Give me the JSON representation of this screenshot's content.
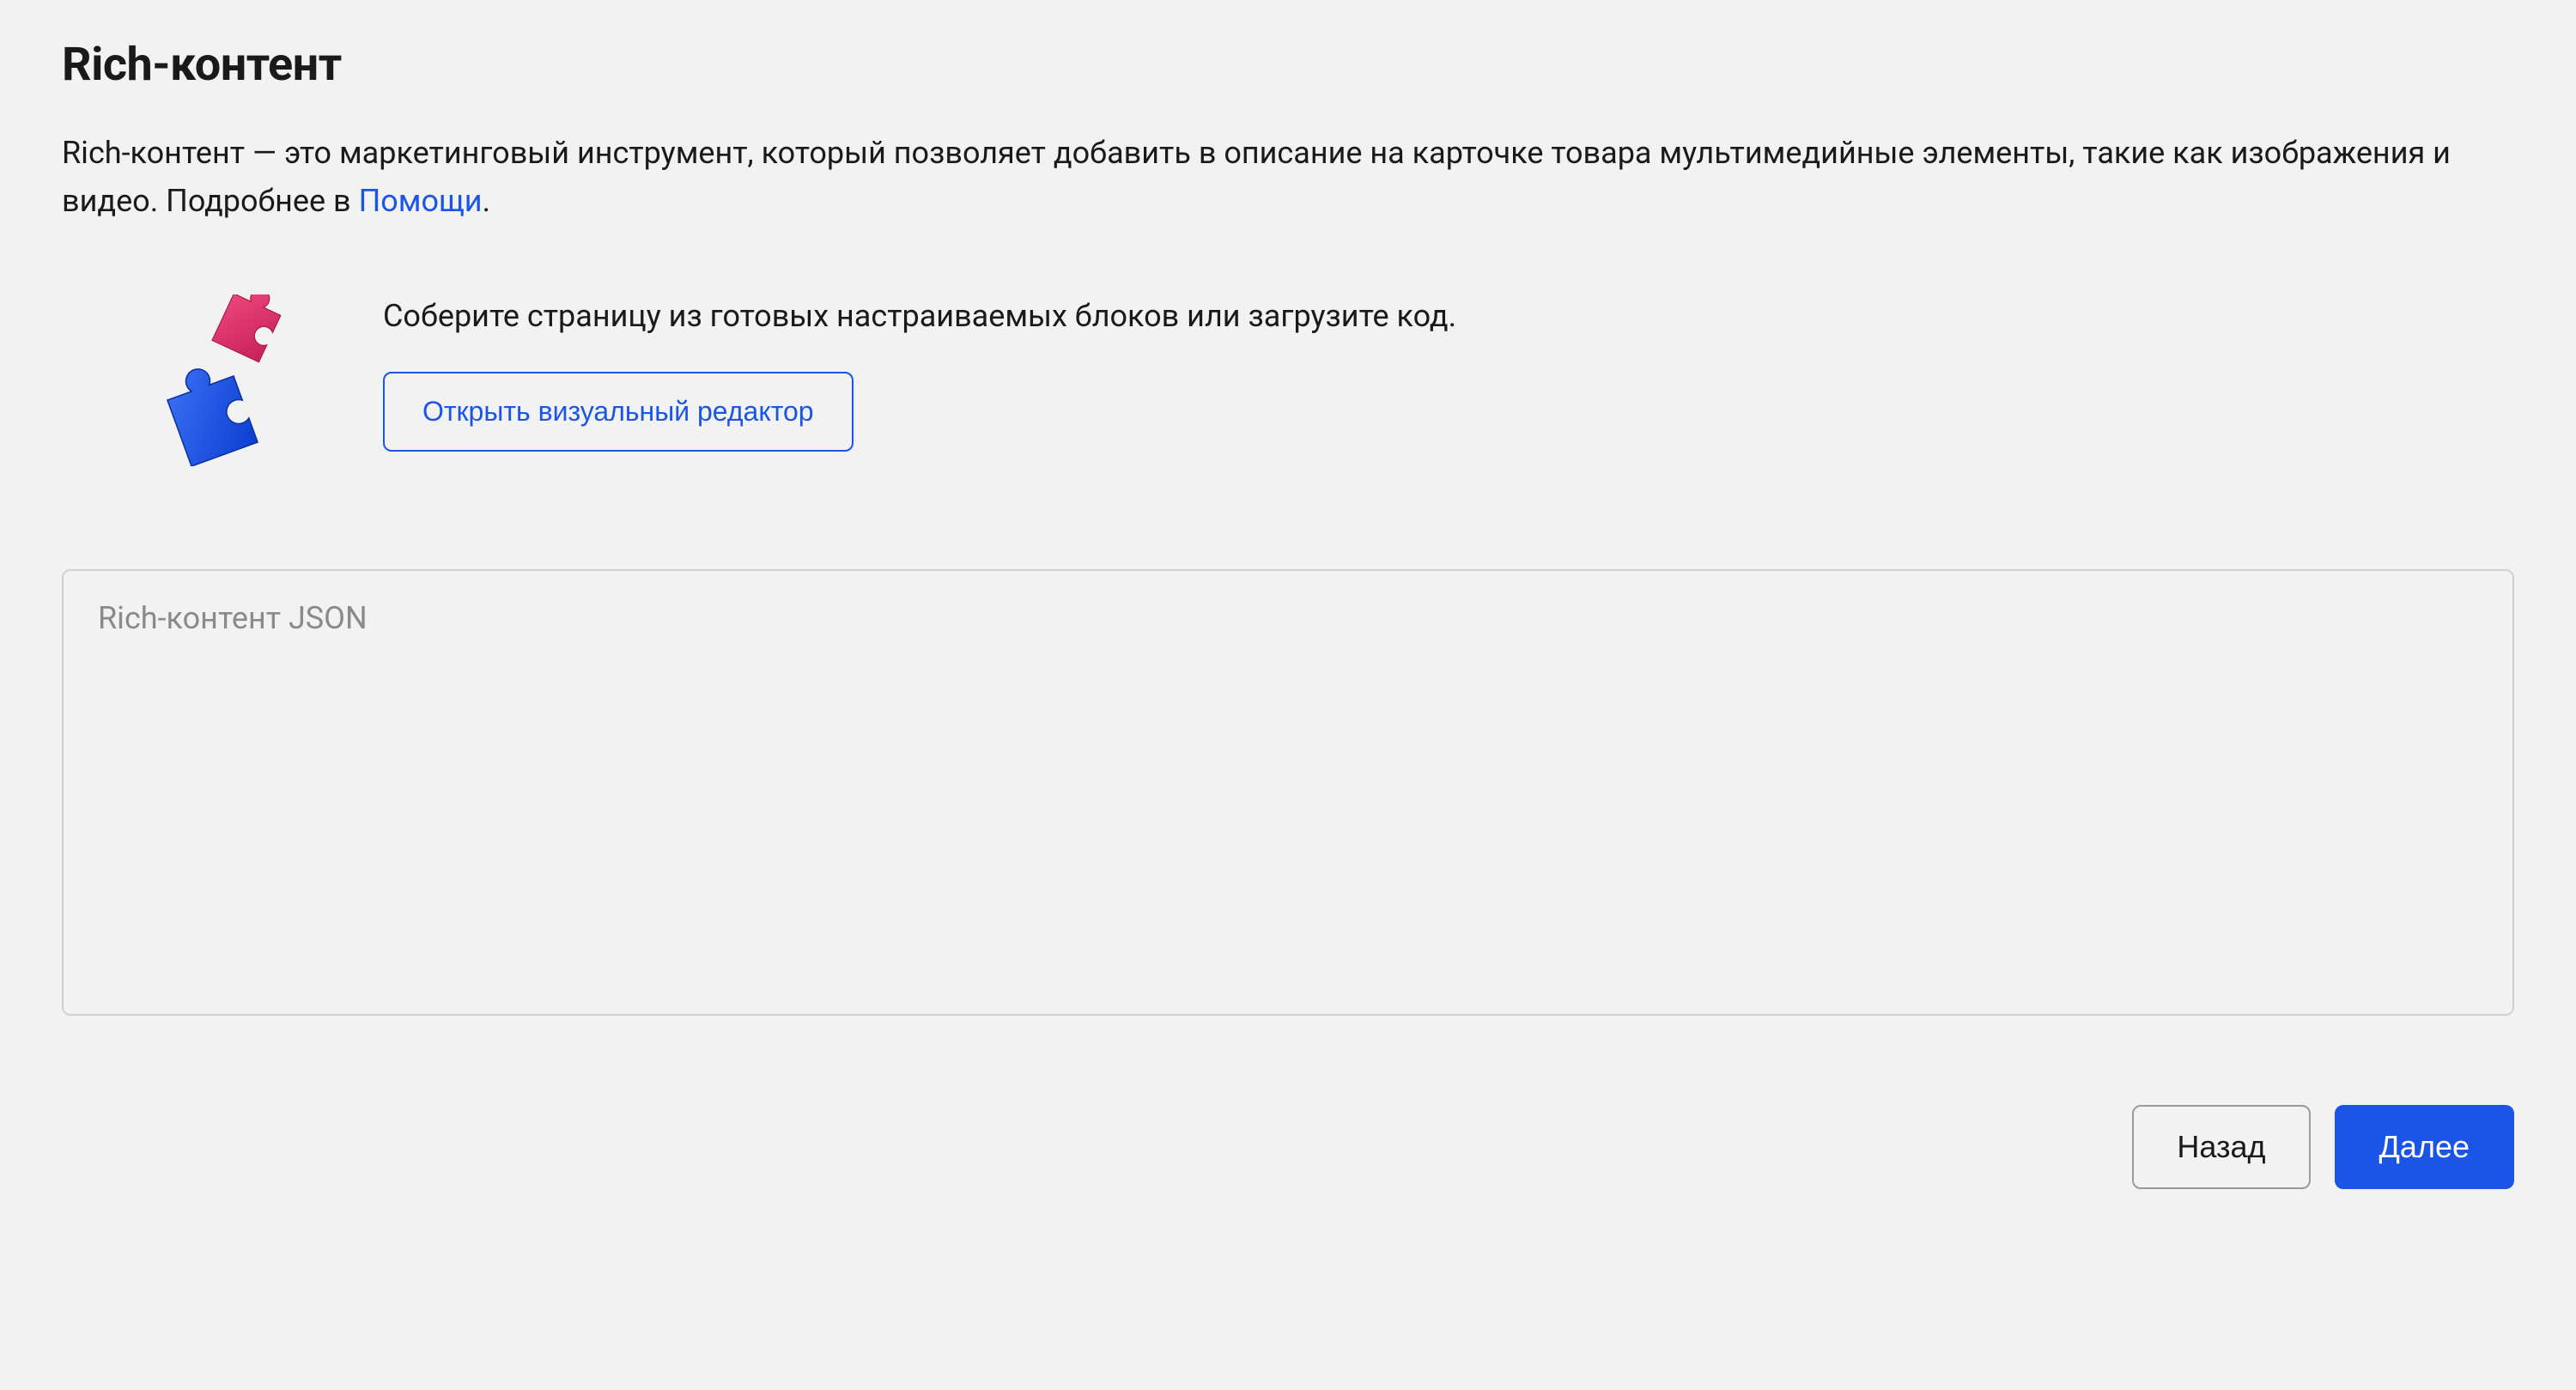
{
  "title": "Rich-контент",
  "description": {
    "text_before": "Rich-контент — это маркетинговый инструмент, который позволяет добавить в описание на карточке товара мультимедийные элементы, такие как изображения и видео. Подробнее в ",
    "link_label": "Помощи",
    "text_after": "."
  },
  "build": {
    "hint": "Соберите страницу из готовых настраиваемых блоков или загрузите код.",
    "open_editor_label": "Открыть визуальный редактор"
  },
  "json_input": {
    "placeholder": "Rich-контент JSON",
    "value": ""
  },
  "actions": {
    "back_label": "Назад",
    "next_label": "Далее"
  },
  "icon": "puzzle-icon",
  "colors": {
    "accent": "#1a55e6",
    "puzzle_pink": "#e6396b",
    "puzzle_blue": "#1a55e6",
    "bg": "#f2f2f2"
  }
}
